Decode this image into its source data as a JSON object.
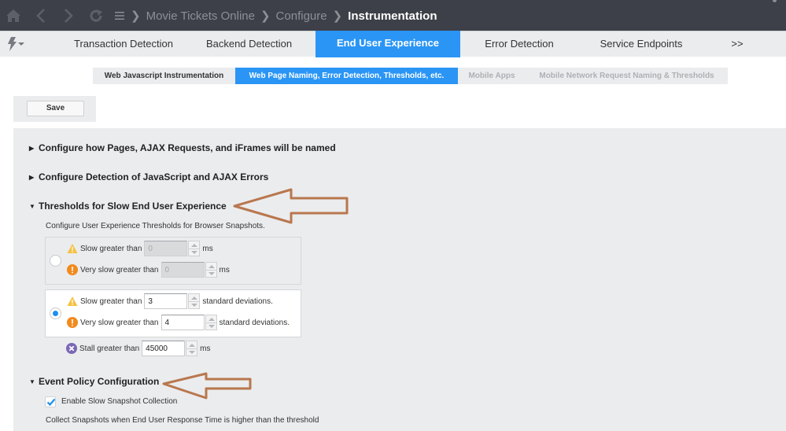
{
  "topbar": {
    "nav_icons": [
      "home-icon",
      "back-icon",
      "forward-icon",
      "refresh-icon",
      "menu-icon"
    ],
    "breadcrumb": [
      {
        "label": "Movie Tickets Online"
      },
      {
        "label": "Configure"
      },
      {
        "label": "Instrumentation"
      }
    ]
  },
  "tabs": {
    "lightning_menu": "lightning-icon",
    "items": [
      {
        "label": "Transaction Detection",
        "active": false
      },
      {
        "label": "Backend Detection",
        "active": false
      },
      {
        "label": "End User Experience",
        "active": true
      },
      {
        "label": "Error Detection",
        "active": false
      },
      {
        "label": "Service Endpoints",
        "active": false
      },
      {
        "label": ">>",
        "active": false
      }
    ]
  },
  "subtabs": [
    {
      "label": "Web Javascript Instrumentation",
      "state": "normal"
    },
    {
      "label": "Web Page Naming, Error Detection, Thresholds, etc.",
      "state": "active"
    },
    {
      "label": "Mobile Apps",
      "state": "disabled"
    },
    {
      "label": "Mobile Network Request Naming & Thresholds",
      "state": "disabled"
    }
  ],
  "toolbar": {
    "save_label": "Save"
  },
  "sections": {
    "naming": {
      "label": "Configure how Pages, AJAX Requests, and iFrames will be named",
      "expanded": false
    },
    "errors": {
      "label": "Configure Detection of JavaScript and AJAX Errors",
      "expanded": false
    },
    "thresholds": {
      "label": "Thresholds for Slow End User Experience",
      "expanded": true,
      "description": "Configure User Experience Thresholds for Browser Snapshots.",
      "static_option": {
        "selected": false,
        "slow_label": "Slow greater than",
        "slow_value": "0",
        "slow_unit": "ms",
        "very_slow_label": "Very slow greater than",
        "very_slow_value": "0",
        "very_slow_unit": "ms"
      },
      "dynamic_option": {
        "selected": true,
        "slow_label": "Slow greater than",
        "slow_value": "3",
        "slow_unit": "standard deviations.",
        "very_slow_label": "Very slow greater than",
        "very_slow_value": "4",
        "very_slow_unit": "standard deviations."
      },
      "stall": {
        "label": "Stall greater than",
        "value": "45000",
        "unit": "ms"
      }
    },
    "event_policy": {
      "label": "Event Policy Configuration",
      "expanded": true,
      "enable_label": "Enable Slow Snapshot Collection",
      "enable_checked": true,
      "description": "Collect Snapshots when End User Response Time is higher than the threshold"
    }
  },
  "colors": {
    "accent": "#2a95f5",
    "topbar": "#3d4048",
    "annotation_arrow": "#b9774e",
    "warning": "#f5c242",
    "error": "#f28a1e",
    "stall": "#7b68b5"
  }
}
